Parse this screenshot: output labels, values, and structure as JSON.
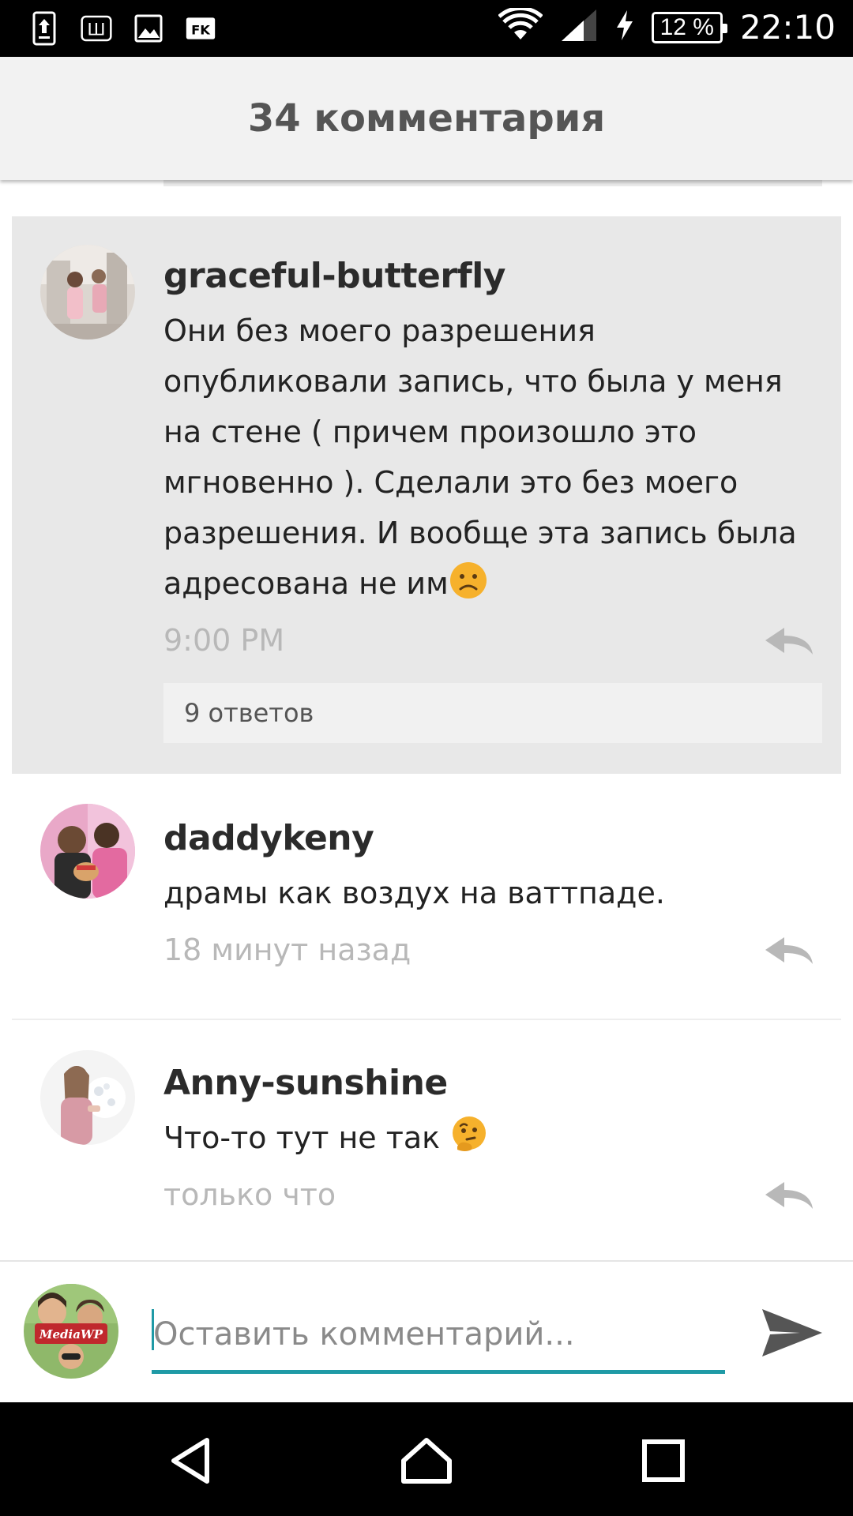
{
  "status_bar": {
    "left_icons": [
      "upload-icon",
      "wattpad-icon",
      "image-icon",
      "fk-app-icon"
    ],
    "wattpad_glyph": "Ш",
    "fk_glyph": "FK",
    "battery": "12 %",
    "time": "22:10"
  },
  "header": {
    "title": "34 комментария"
  },
  "comments": [
    {
      "username": "graceful-butterfly",
      "text": "Они без моего разрешения опубликовали запись, что была у меня на стене ( причем произошло это мгновенно ). Сделали это без моего разрешения. И вообще эта запись была адресована не им",
      "emoji": "frowning-face-emoji",
      "time": "9:00 PM",
      "replies": "9 ответов",
      "highlighted": true
    },
    {
      "username": "daddykeny",
      "text": "драмы как воздух на ваттпаде.",
      "time": "18 минут назад"
    },
    {
      "username": "Anny-sunshine",
      "text": "Что-то тут не так",
      "emoji": "thinking-face-emoji",
      "time": "только что"
    }
  ],
  "composer": {
    "placeholder": "Оставить комментарий...",
    "avatar_label": "MediaWP"
  },
  "nav": [
    "back-icon",
    "home-icon",
    "recents-icon"
  ],
  "colors": {
    "accent": "#1f9aa6",
    "highlight_bg": "#e8e8e8",
    "header_bg": "#f2f2f2",
    "timestamp": "#b8b8b8"
  }
}
